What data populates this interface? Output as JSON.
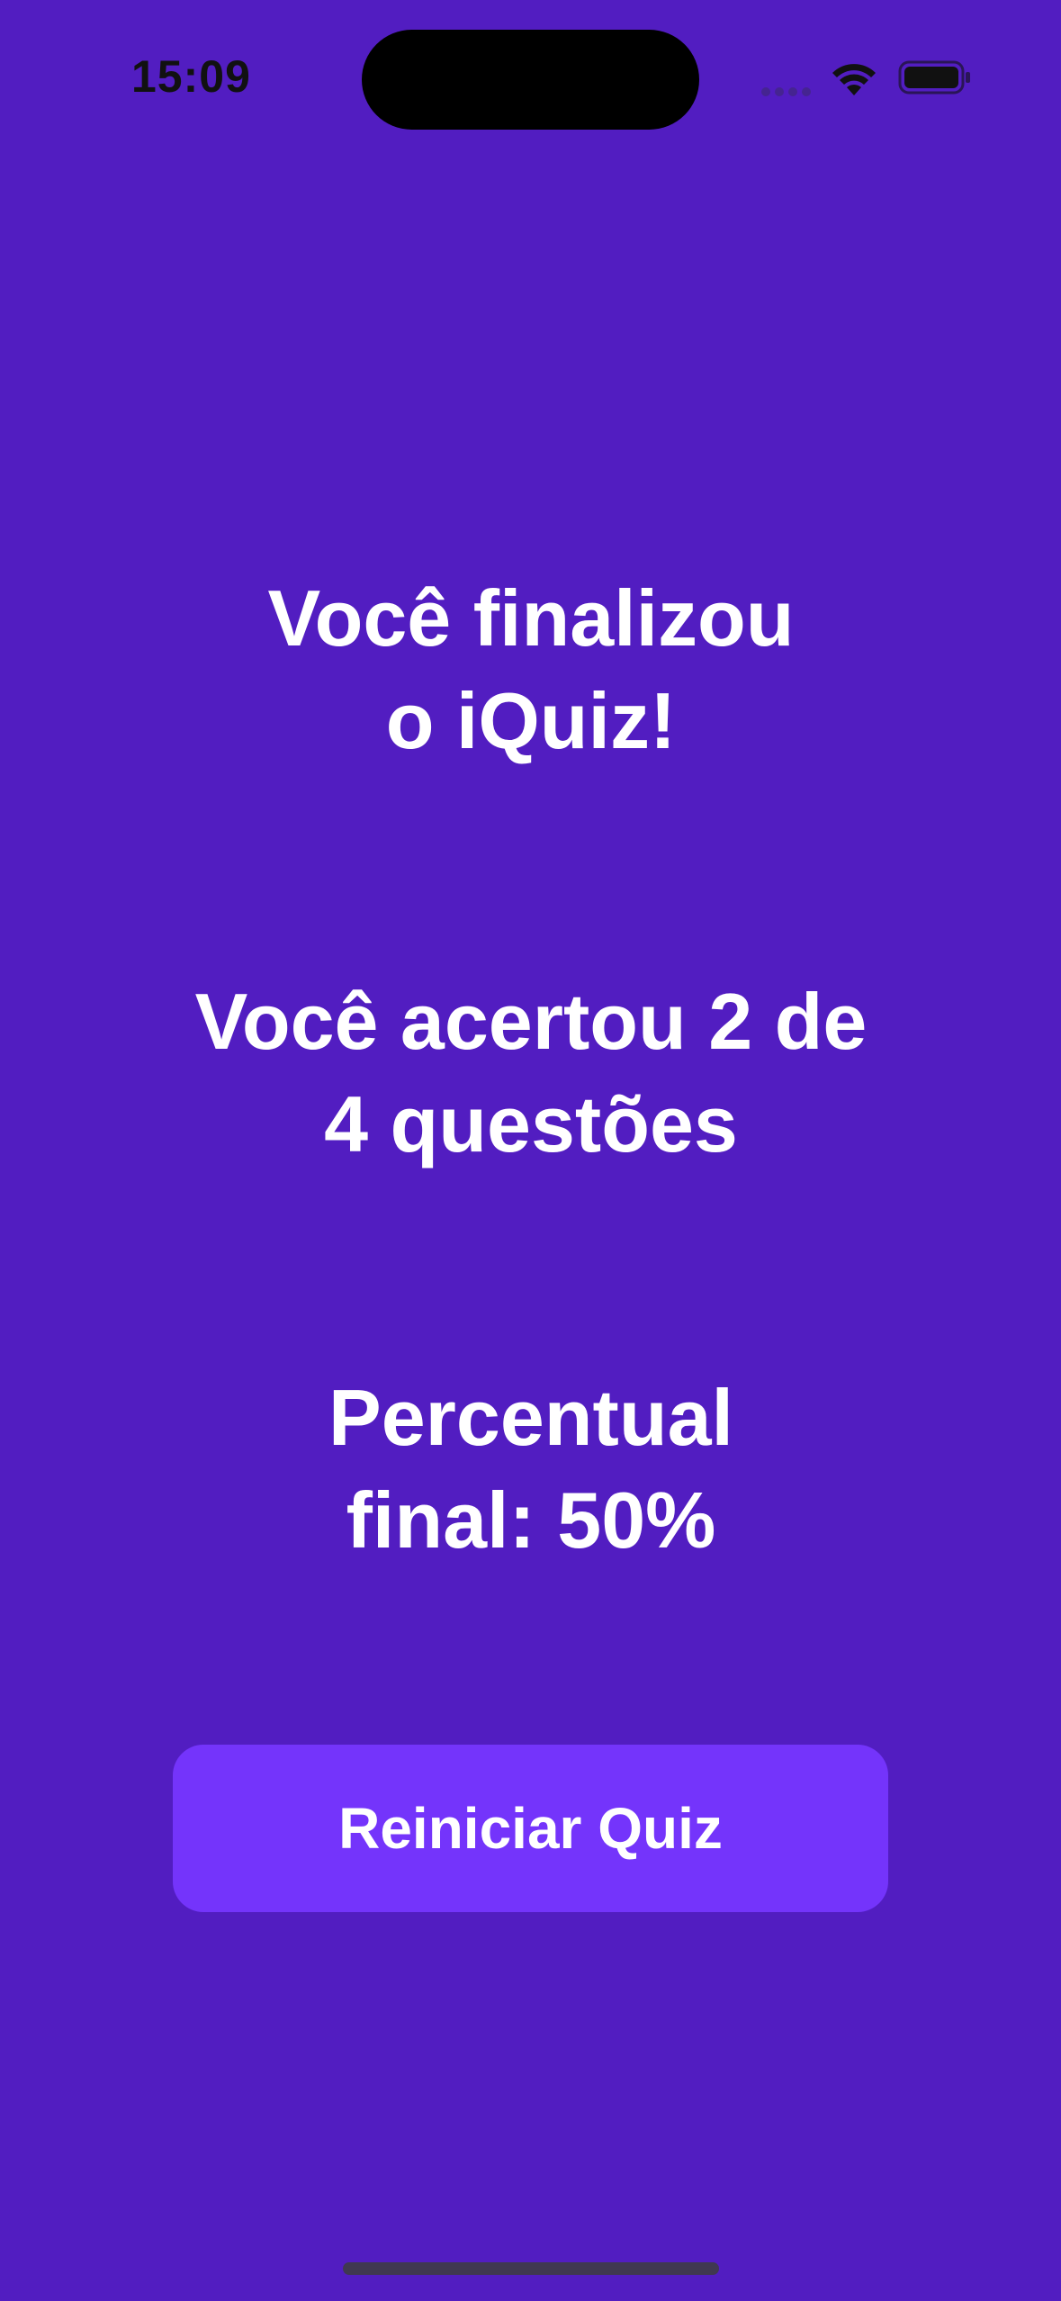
{
  "status_bar": {
    "time": "15:09",
    "icons": [
      "cellular-signal-icon",
      "wifi-icon",
      "battery-icon"
    ]
  },
  "result": {
    "title": "Você finalizou o iQuiz!",
    "score_text": "Você acertou 2 de 4 questões",
    "percentage_text": "Percentual final: 50%"
  },
  "actions": {
    "restart_label": "Reiniciar Quiz"
  },
  "colors": {
    "background": "#521dc1",
    "button": "#7434fb",
    "text": "#ffffff"
  }
}
